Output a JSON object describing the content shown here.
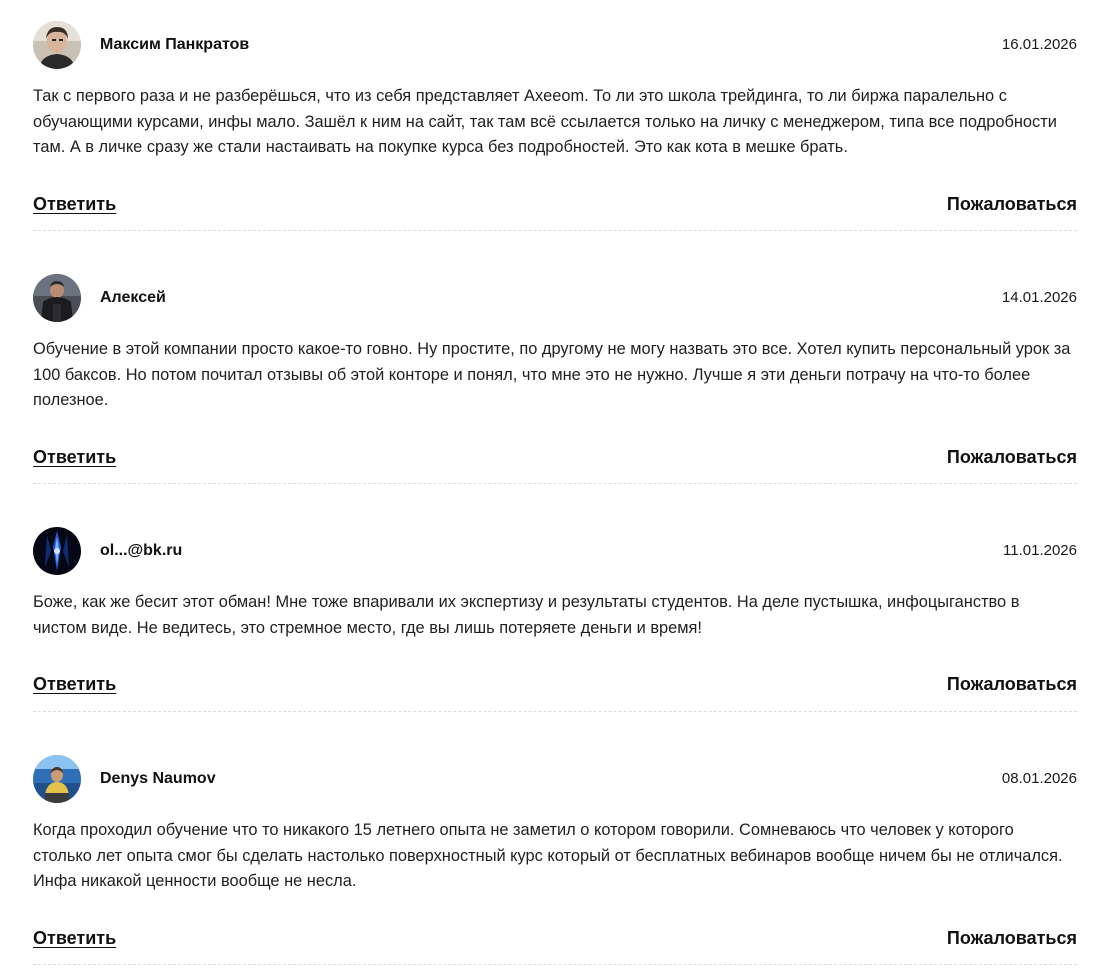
{
  "comments": [
    {
      "author": "Максим Панкратов",
      "date": "16.01.2026",
      "text": "Так с первого раза и не разберёшься, что из себя представляет Axeeom. То ли это школа трейдинга, то ли биржа паралельно с обучающими курсами, инфы мало. Зашёл к ним на сайт, так там всё ссылается только на личку с менеджером, типа все подробности там. А в личке сразу же стали настаивать на покупке курса без подробностей. Это как кота в мешке брать.",
      "reply_label": "Ответить",
      "report_label": "Пожаловаться",
      "avatar_icon": "user-photo-icon"
    },
    {
      "author": "Алексей",
      "date": "14.01.2026",
      "text": "Обучение в этой компании просто какое-то говно. Ну простите, по другому не могу назвать это все. Хотел купить персональный урок за 100 баксов. Но потом почитал отзывы об этой конторе и понял, что мне это не нужно. Лучше я эти деньги потрачу на что-то более полезное.",
      "reply_label": "Ответить",
      "report_label": "Пожаловаться",
      "avatar_icon": "user-photo-icon"
    },
    {
      "author": "ol...@bk.ru",
      "date": "11.01.2026",
      "text": "Боже, как же бесит этот обман! Мне тоже впаривали их экспертизу и результаты студентов. На деле пустышка, инфоцыганство в чистом виде. Не ведитесь, это стремное место, где вы лишь потеряете деньги и время!",
      "reply_label": "Ответить",
      "report_label": "Пожаловаться",
      "avatar_icon": "user-photo-icon"
    },
    {
      "author": "Denys Naumov",
      "date": "08.01.2026",
      "text": "Когда проходил обучение что то никакого 15 летнего опыта не заметил о котором говорили. Сомневаюсь что человек у которого столько лет опыта смог бы сделать настолько поверхностный курс который от бесплатных вебинаров вообще ничем бы не отличался. Инфа никакой ценности вообще не несла.",
      "reply_label": "Ответить",
      "report_label": "Пожаловаться",
      "avatar_icon": "user-photo-icon"
    }
  ]
}
